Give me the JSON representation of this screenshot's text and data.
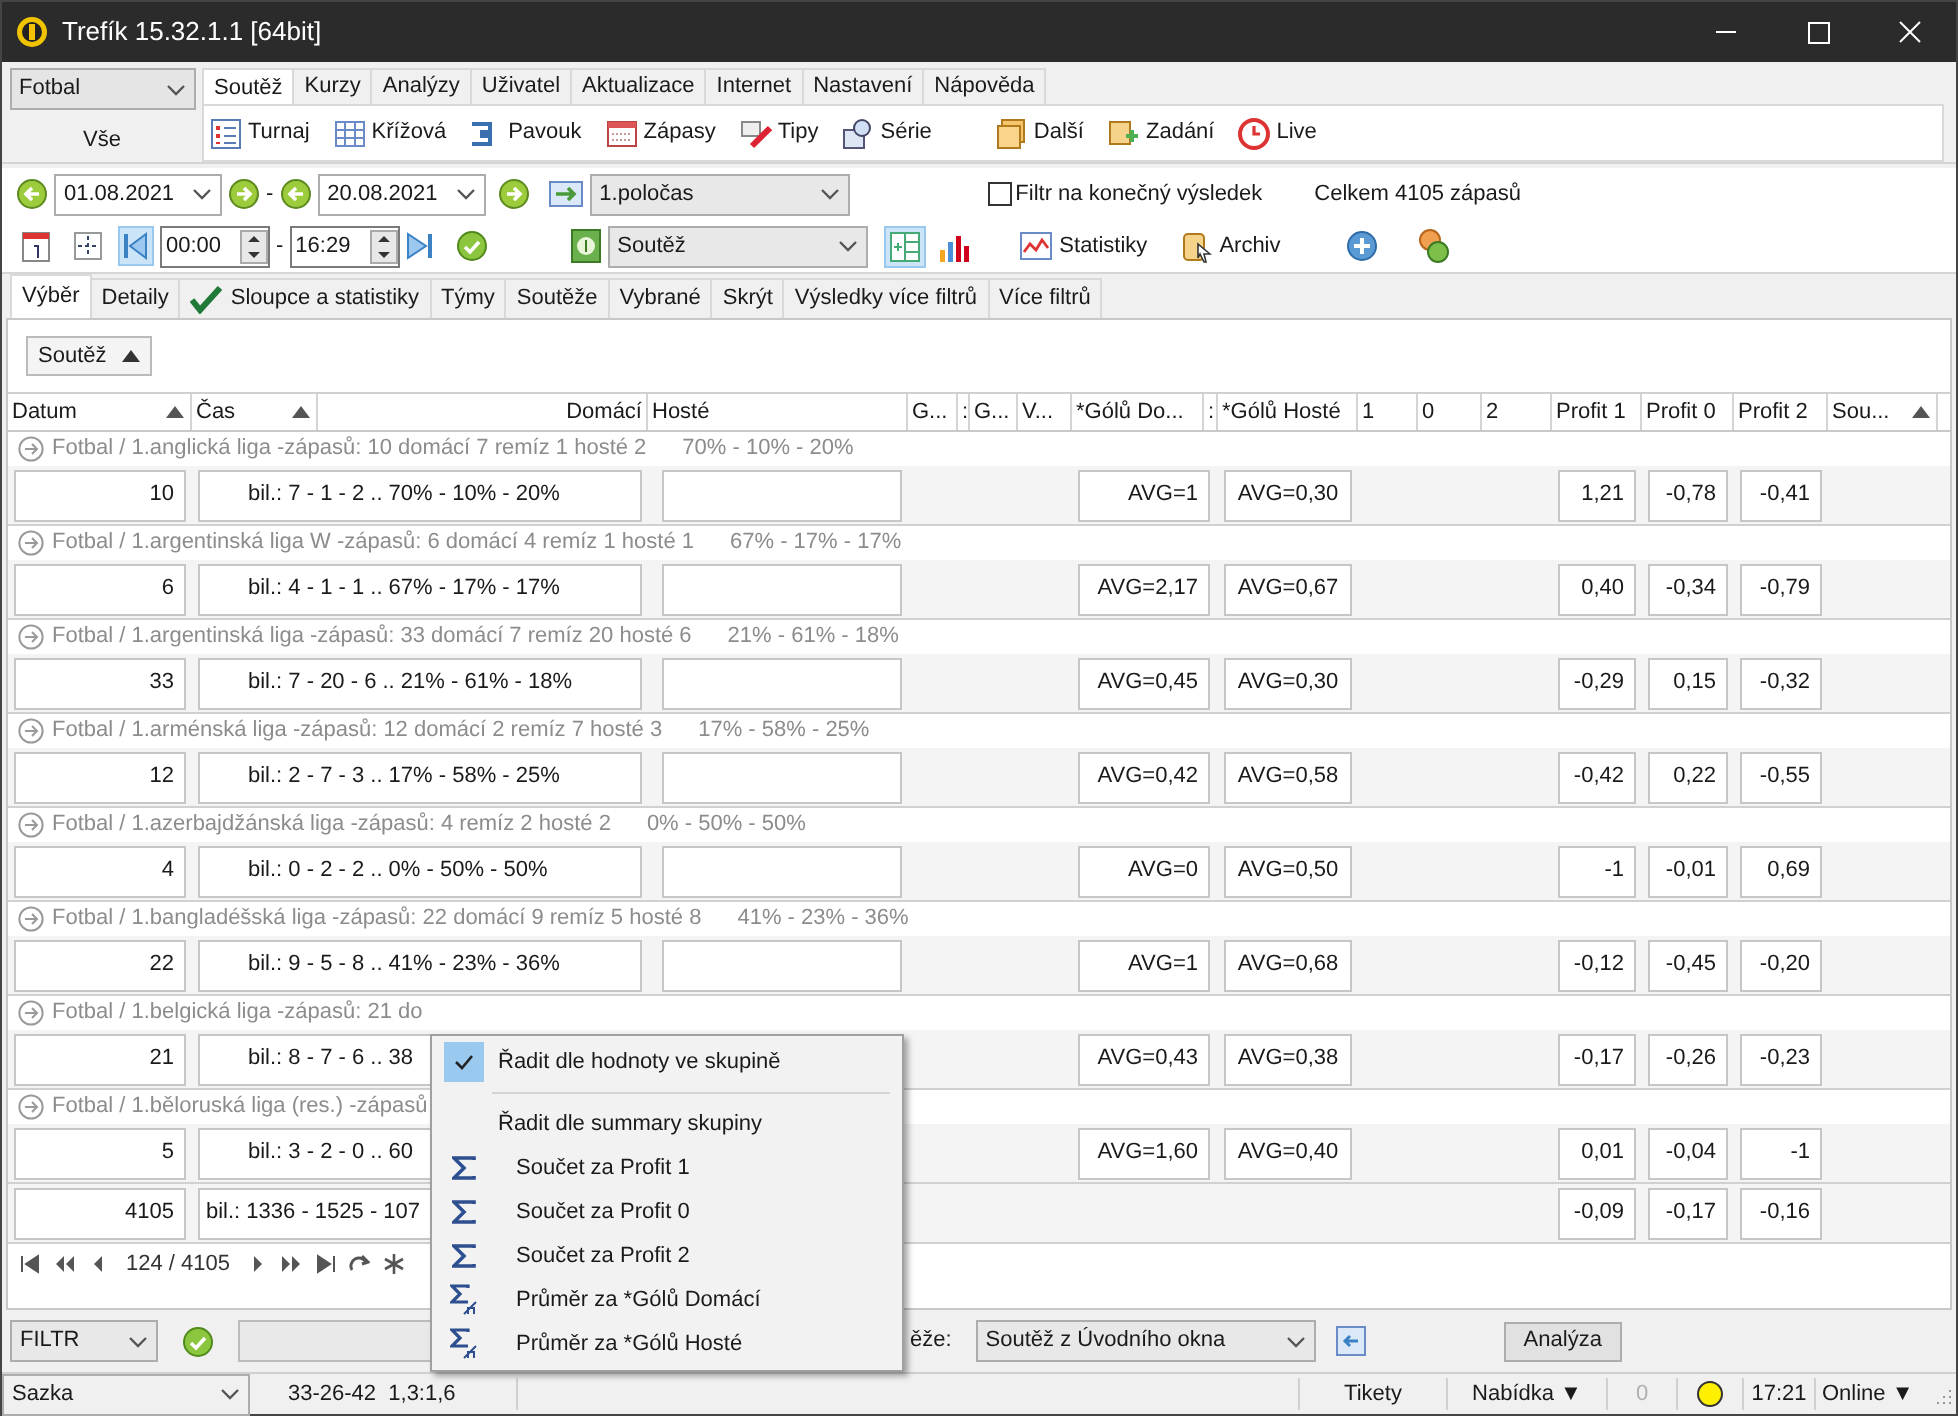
{
  "window": {
    "title": "Trefík 15.32.1.1 [64bit]"
  },
  "sport_select": {
    "value": "Fotbal"
  },
  "scope_label": "Vše",
  "ribbon_tabs": [
    {
      "label": "Soutěž",
      "selected": true
    },
    {
      "label": "Kurzy",
      "selected": false
    },
    {
      "label": "Analýzy",
      "selected": false
    },
    {
      "label": "Uživatel",
      "selected": false
    },
    {
      "label": "Aktualizace",
      "selected": false
    },
    {
      "label": "Internet",
      "selected": false
    },
    {
      "label": "Nastavení",
      "selected": false
    },
    {
      "label": "Nápověda",
      "selected": false
    }
  ],
  "ribbon_buttons": [
    "Turnaj",
    "Křížová",
    "Pavouk",
    "Zápasy",
    "Tipy",
    "Série",
    "Další",
    "Zadání",
    "Live"
  ],
  "filter": {
    "date_from": "01.08.2021",
    "date_to": "20.08.2021",
    "range_separator": "-",
    "period": "1.poločas",
    "final_result_filter": {
      "label": "Filtr na konečný výsledek",
      "checked": false
    },
    "total": "Celkem 4105 zápasů",
    "time_from": "00:00",
    "time_separator": "-",
    "time_to": "16:29",
    "competition": "Soutěž",
    "statistics_button": "Statistiky",
    "archive_button": "Archiv"
  },
  "section_tabs": [
    {
      "label": "Výběr",
      "selected": true,
      "checked": false
    },
    {
      "label": "Detaily",
      "selected": false,
      "checked": false
    },
    {
      "label": "Sloupce a statistiky",
      "selected": false,
      "checked": true
    },
    {
      "label": "Týmy",
      "selected": false,
      "checked": false
    },
    {
      "label": "Soutěže",
      "selected": false,
      "checked": false
    },
    {
      "label": "Vybrané",
      "selected": false,
      "checked": false
    },
    {
      "label": "Skrýt",
      "selected": false,
      "checked": false
    },
    {
      "label": "Výsledky více filtrů",
      "selected": false,
      "checked": false
    },
    {
      "label": "Více filtrů",
      "selected": false,
      "checked": false
    }
  ],
  "group_by": {
    "label": "Soutěž"
  },
  "table": {
    "columns": [
      {
        "label": "Datum",
        "sorted": true
      },
      {
        "label": "Čas",
        "sorted": true
      },
      {
        "label": "Domácí",
        "sorted": false
      },
      {
        "label": "Hosté",
        "sorted": false
      },
      {
        "label": "G...",
        "sorted": false
      },
      {
        "label": ":",
        "sorted": false
      },
      {
        "label": "G...",
        "sorted": false
      },
      {
        "label": "V...",
        "sorted": false
      },
      {
        "label": "*Gólů Do...",
        "sorted": false
      },
      {
        "label": ":",
        "sorted": false
      },
      {
        "label": "*Gólů Hosté",
        "sorted": false
      },
      {
        "label": "1",
        "sorted": false
      },
      {
        "label": "0",
        "sorted": false
      },
      {
        "label": "2",
        "sorted": false
      },
      {
        "label": "Profit 1",
        "sorted": false
      },
      {
        "label": "Profit 0",
        "sorted": false
      },
      {
        "label": "Profit 2",
        "sorted": false
      },
      {
        "label": "Sou...",
        "sorted": true
      }
    ],
    "groups": [
      {
        "header": "Fotbal / 1.anglická liga -zápasů: 10  domácí 7  remíz 1  hosté 2",
        "ratio": "70% - 10% - 20%",
        "count": "10",
        "balance": "bil.: 7 - 1 - 2 .. 70% - 10% - 20%",
        "avg_home": "AVG=1",
        "avg_away": "AVG=0,30",
        "profit_1": "1,21",
        "profit_0": "-0,78",
        "profit_2": "-0,41"
      },
      {
        "header": "Fotbal / 1.argentinská liga W -zápasů: 6  domácí 4  remíz 1  hosté 1",
        "ratio": "67% - 17% - 17%",
        "count": "6",
        "balance": "bil.: 4 - 1 - 1 .. 67% - 17% - 17%",
        "avg_home": "AVG=2,17",
        "avg_away": "AVG=0,67",
        "profit_1": "0,40",
        "profit_0": "-0,34",
        "profit_2": "-0,79"
      },
      {
        "header": "Fotbal / 1.argentinská liga -zápasů: 33  domácí 7  remíz 20  hosté 6",
        "ratio": "21% - 61% - 18%",
        "count": "33",
        "balance": "bil.: 7 - 20 - 6 .. 21% - 61% - 18%",
        "avg_home": "AVG=0,45",
        "avg_away": "AVG=0,30",
        "profit_1": "-0,29",
        "profit_0": "0,15",
        "profit_2": "-0,32"
      },
      {
        "header": "Fotbal / 1.arménská liga -zápasů: 12  domácí 2  remíz 7  hosté 3",
        "ratio": "17% - 58% - 25%",
        "count": "12",
        "balance": "bil.: 2 - 7 - 3 .. 17% - 58% - 25%",
        "avg_home": "AVG=0,42",
        "avg_away": "AVG=0,58",
        "profit_1": "-0,42",
        "profit_0": "0,22",
        "profit_2": "-0,55"
      },
      {
        "header": "Fotbal / 1.azerbajdžánská liga -zápasů: 4  remíz 2  hosté 2",
        "ratio": "0% - 50% - 50%",
        "count": "4",
        "balance": "bil.: 0 - 2 - 2 .. 0% - 50% - 50%",
        "avg_home": "AVG=0",
        "avg_away": "AVG=0,50",
        "profit_1": "-1",
        "profit_0": "-0,01",
        "profit_2": "0,69"
      },
      {
        "header": "Fotbal / 1.bangladéšská liga -zápasů: 22  domácí 9  remíz 5  hosté 8",
        "ratio": "41% - 23% - 36%",
        "count": "22",
        "balance": "bil.: 9 - 5 - 8 .. 41% - 23% - 36%",
        "avg_home": "AVG=1",
        "avg_away": "AVG=0,68",
        "profit_1": "-0,12",
        "profit_0": "-0,45",
        "profit_2": "-0,20"
      },
      {
        "header": "Fotbal / 1.belgická liga -zápasů: 21  do",
        "count": "21",
        "balance": "bil.: 8 - 7 - 6 .. 38",
        "avg_home": "AVG=0,43",
        "avg_away": "AVG=0,38",
        "profit_1": "-0,17",
        "profit_0": "-0,26",
        "profit_2": "-0,23"
      },
      {
        "header": "Fotbal / 1.běloruská liga (res.) -zápasů",
        "count": "5",
        "balance": "bil.: 3 - 2 - 0 .. 60",
        "avg_home": "AVG=1,60",
        "avg_away": "AVG=0,40",
        "profit_1": "0,01",
        "profit_0": "-0,04",
        "profit_2": "-1"
      }
    ],
    "total": {
      "count": "4105",
      "balance": "bil.: 1336 - 1525 - 107",
      "profit_1": "-0,09",
      "profit_0": "-0,17",
      "profit_2": "-0,16"
    }
  },
  "navigator": {
    "position": "124 / 4105"
  },
  "bottom_bar": {
    "filter_select": "FILTR",
    "competition_label": "ěže:",
    "competition_select": "Soutěž z Úvodního okna",
    "analysis_button": "Analýza"
  },
  "status_bar": {
    "bookmaker": "Sazka",
    "odds_info": "33-26-42  1,3:1,6",
    "tickets": "Tikety",
    "offer": "Nabídka ▼",
    "counter": "0",
    "time": "17:21",
    "online": "Online ▼"
  },
  "context_menu": {
    "items": [
      {
        "kind": "check",
        "label": "Řadit dle hodnoty ve skupině",
        "checked": true
      },
      {
        "kind": "separator"
      },
      {
        "kind": "plain",
        "label": "Řadit dle summary skupiny"
      },
      {
        "kind": "sum",
        "label": "Součet za Profit 1"
      },
      {
        "kind": "sum",
        "label": "Součet za Profit 0"
      },
      {
        "kind": "sum",
        "label": "Součet za Profit 2"
      },
      {
        "kind": "average",
        "label": "Průměr za *Gólů Domácí"
      },
      {
        "kind": "average",
        "label": "Průměr za *Gólů Hosté"
      }
    ]
  }
}
